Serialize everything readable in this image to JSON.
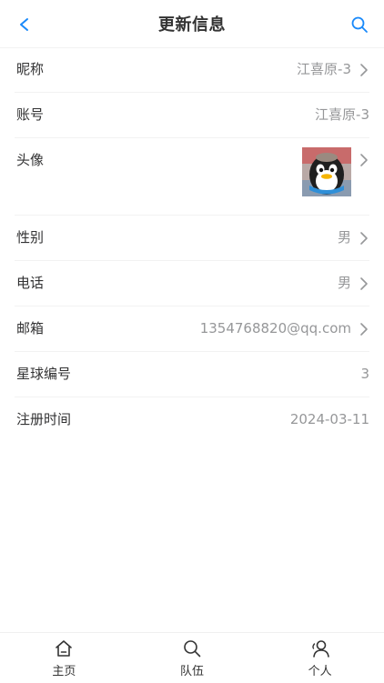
{
  "header": {
    "title": "更新信息",
    "back_icon": "chevron-left-icon",
    "search_icon": "search-icon",
    "accent_color": "#1989fa"
  },
  "fields": [
    {
      "label": "昵称",
      "value": "江喜原-3",
      "has_arrow": true
    },
    {
      "label": "账号",
      "value": "江喜原-3",
      "has_arrow": false
    },
    {
      "label": "头像",
      "value": "",
      "has_arrow": true,
      "avatar": "penguin-avatar"
    },
    {
      "label": "性别",
      "value": "男",
      "has_arrow": true
    },
    {
      "label": "电话",
      "value": "男",
      "has_arrow": true
    },
    {
      "label": "邮箱",
      "value": "1354768820@qq.com",
      "has_arrow": true
    },
    {
      "label": "星球编号",
      "value": "3",
      "has_arrow": false
    },
    {
      "label": "注册时间",
      "value": "2024-03-11",
      "has_arrow": false
    }
  ],
  "tabbar": {
    "items": [
      {
        "label": "主页",
        "icon": "home-icon"
      },
      {
        "label": "队伍",
        "icon": "search-icon"
      },
      {
        "label": "个人",
        "icon": "user-icon"
      }
    ]
  }
}
